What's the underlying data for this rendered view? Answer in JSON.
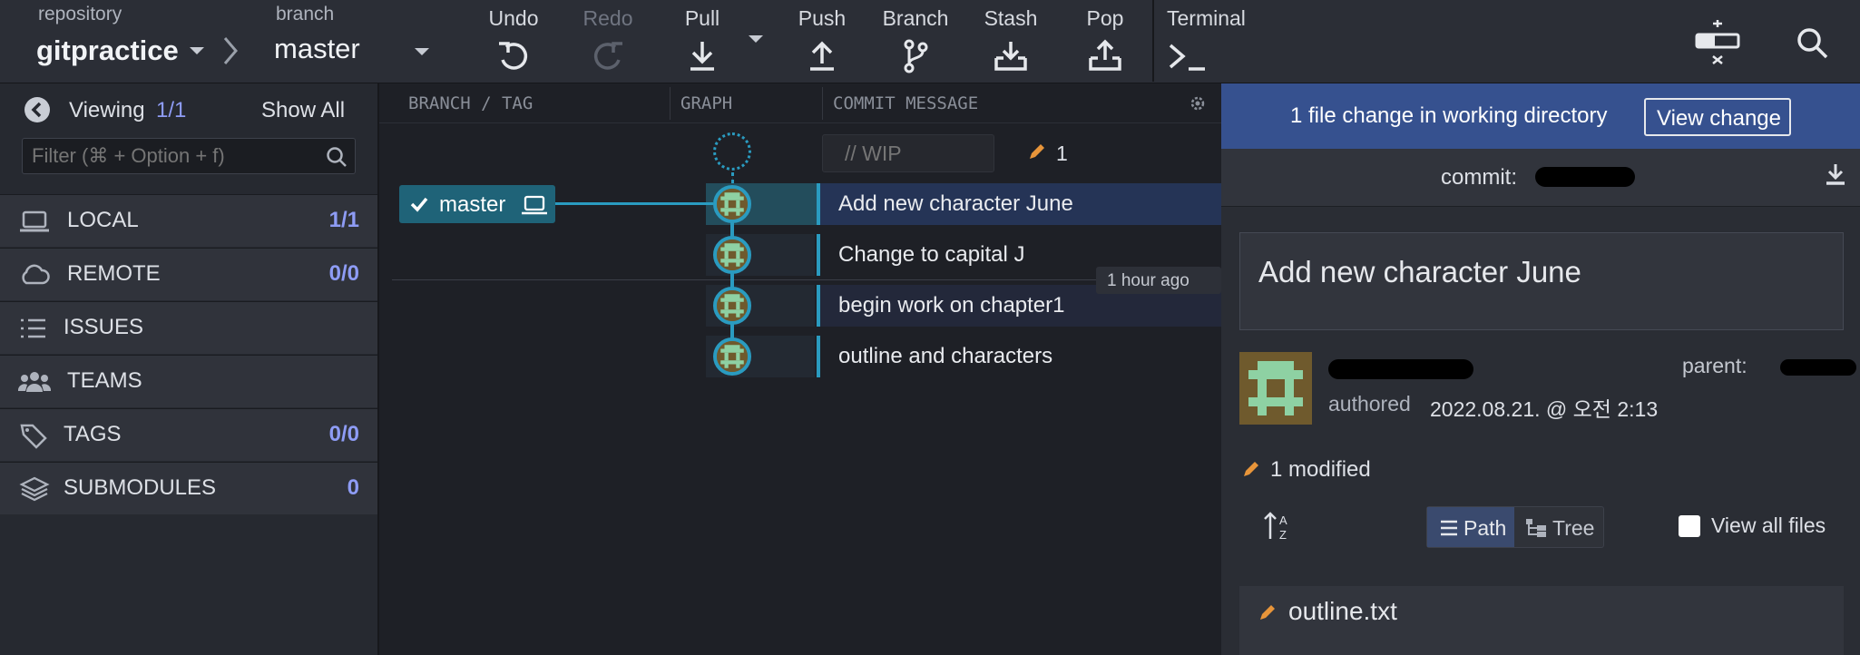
{
  "toolbar": {
    "repository_label": "repository",
    "repository_name": "gitpractice",
    "branch_label": "branch",
    "branch_name": "master",
    "buttons": {
      "undo": "Undo",
      "redo": "Redo",
      "pull": "Pull",
      "push": "Push",
      "branch": "Branch",
      "stash": "Stash",
      "pop": "Pop",
      "terminal": "Terminal"
    }
  },
  "left_panel": {
    "viewing_label": "Viewing",
    "viewing_count": "1/1",
    "show_all": "Show All",
    "filter_placeholder": "Filter (⌘ + Option + f)",
    "items": [
      {
        "label": "LOCAL",
        "count": "1/1",
        "icon": "laptop-icon"
      },
      {
        "label": "REMOTE",
        "count": "0/0",
        "icon": "cloud-icon"
      },
      {
        "label": "ISSUES",
        "count": "",
        "icon": "list-icon"
      },
      {
        "label": "TEAMS",
        "count": "",
        "icon": "users-icon"
      },
      {
        "label": "TAGS",
        "count": "0/0",
        "icon": "tag-icon"
      },
      {
        "label": "SUBMODULES",
        "count": "0",
        "icon": "layers-icon"
      }
    ]
  },
  "graph": {
    "headers": {
      "branch_tag": "BRANCH / TAG",
      "graph": "GRAPH",
      "commit_message": "COMMIT MESSAGE"
    },
    "wip_placeholder": "// WIP",
    "wip_count": "1",
    "branch_label": "master",
    "time_tooltip": "1 hour ago",
    "commits": [
      "Add new character June",
      "Change to capital J",
      "begin work on chapter1",
      "outline and characters"
    ]
  },
  "right_panel": {
    "banner_text": "1 file change in working directory",
    "view_change": "View change",
    "commit_label": "commit:",
    "summary": "Add new character June",
    "parent_label": "parent:",
    "authored_label": "authored",
    "authored_date": "2022.08.21. @ 오전 2:13",
    "modified_text": "1 modified",
    "path_label": "Path",
    "tree_label": "Tree",
    "view_all_files": "View all files",
    "file_name": "outline.txt"
  },
  "colors": {
    "accent": "#2a9bc0",
    "banner": "#36518f",
    "count": "#8e9cf5",
    "pencil": "#e8953a"
  }
}
